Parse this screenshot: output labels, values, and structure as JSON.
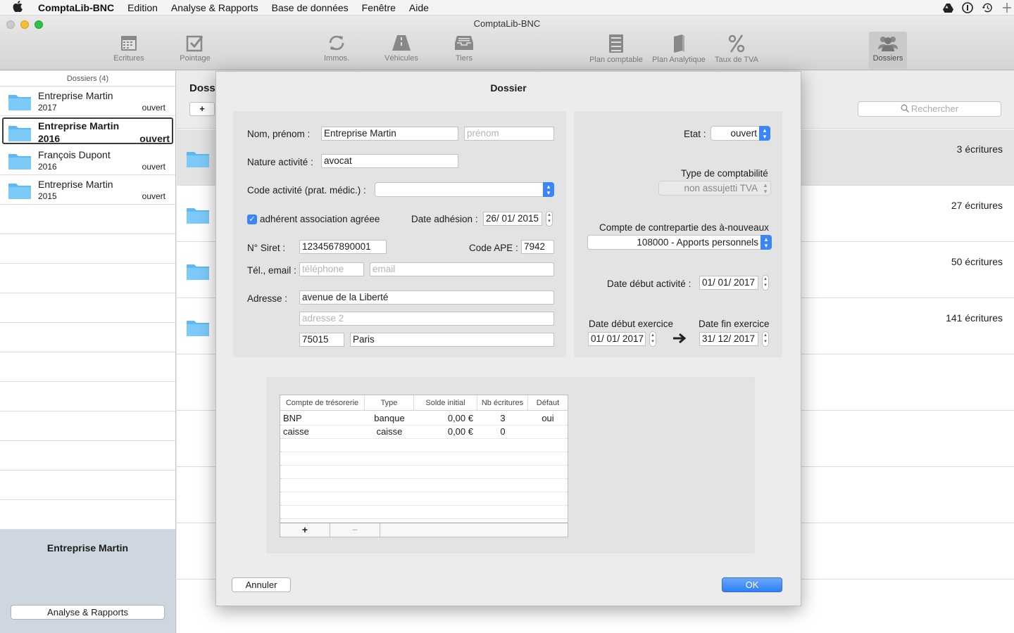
{
  "menubar": {
    "app": "ComptaLib-BNC",
    "items": [
      "Edition",
      "Analyse & Rapports",
      "Base de données",
      "Fenêtre",
      "Aide"
    ]
  },
  "window": {
    "title": "ComptaLib-BNC"
  },
  "toolbar": {
    "ecritures": "Ecritures",
    "pointage": "Pointage",
    "immos": "Immos.",
    "vehicules": "Véhicules",
    "tiers": "Tiers",
    "plan_comptable": "Plan comptable",
    "plan_analytique": "Plan Analytique",
    "taux_tva": "Taux de TVA",
    "dossiers": "Dossiers"
  },
  "sidebar": {
    "header": "Dossiers (4)",
    "items": [
      {
        "name": "Entreprise Martin",
        "year": "2017",
        "status": "ouvert"
      },
      {
        "name": "Entreprise Martin",
        "year": "2016",
        "status": "ouvert"
      },
      {
        "name": "François Dupont",
        "year": "2016",
        "status": "ouvert"
      },
      {
        "name": "Entreprise Martin",
        "year": "2015",
        "status": "ouvert"
      }
    ],
    "selected_name": "Entreprise Martin",
    "analyse_button": "Analyse & Rapports"
  },
  "main": {
    "title": "Dossi",
    "add": "+",
    "search_placeholder": "Rechercher",
    "counts": [
      "3 écritures",
      "27 écritures",
      "50 écritures",
      "141 écritures"
    ]
  },
  "sheet": {
    "title": "Dossier",
    "nom_label": "Nom, prénom :",
    "nom_value": "Entreprise Martin",
    "prenom_placeholder": "prénom",
    "nature_label": "Nature activité :",
    "nature_value": "avocat",
    "code_activite_label": "Code activité (prat. médic.) :",
    "code_activite_value": "",
    "adherent_label": "adhérent association agréee",
    "date_adhesion_label": "Date adhésion :",
    "date_adhesion_value": "26/ 01/ 2015",
    "siret_label": "N° Siret  :",
    "siret_value": "1234567890001",
    "ape_label": "Code APE :",
    "ape_value": "7942",
    "tel_label": "Tél., email :",
    "tel_placeholder": "téléphone",
    "email_placeholder": "email",
    "adresse_label": "Adresse :",
    "adresse1": "avenue de la Liberté",
    "adresse2_placeholder": "adresse 2",
    "cp": "75015",
    "ville": "Paris",
    "etat_label": "Etat :",
    "etat_value": "ouvert",
    "type_compta_label": "Type de comptabilité",
    "type_compta_value": "non assujetti TVA",
    "contrepartie_label": "Compte de contrepartie des à-nouveaux",
    "contrepartie_value": "108000 - Apports personnels",
    "date_debut_activite_label": "Date début activité :",
    "date_debut_activite_value": "01/ 01/ 2017",
    "date_debut_exercice_label": "Date début exercice",
    "date_debut_exercice_value": "01/ 01/ 2017",
    "date_fin_exercice_label": "Date fin exercice",
    "date_fin_exercice_value": "31/ 12/ 2017",
    "table": {
      "headers": [
        "Compte de trésorerie",
        "Type",
        "Solde initial",
        "Nb écritures",
        "Défaut"
      ],
      "rows": [
        [
          "BNP",
          "banque",
          "0,00 €",
          "3",
          "oui"
        ],
        [
          "caisse",
          "caisse",
          "0,00 €",
          "0",
          ""
        ]
      ],
      "add": "+",
      "remove": "−"
    },
    "cancel": "Annuler",
    "ok": "OK"
  },
  "colors": {
    "accent": "#3b86f7",
    "folder": "#5eb8f2",
    "sidebar_bottom": "#ced7e0"
  }
}
